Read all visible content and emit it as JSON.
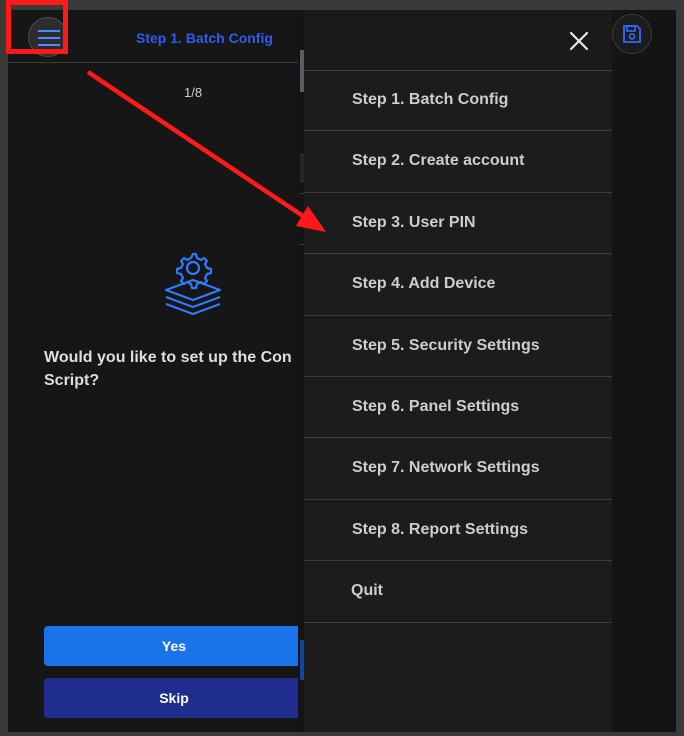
{
  "header": {
    "title": "Step 1. Batch Config",
    "menu_icon": "hamburger-menu-icon",
    "save_icon": "save-icon"
  },
  "pager": {
    "text": "1/8"
  },
  "question": {
    "line1": "Would you like to set up the Con",
    "line2": "Script?"
  },
  "buttons": {
    "yes": "Yes",
    "skip": "Skip"
  },
  "drawer": {
    "close_icon": "close-icon",
    "items": [
      {
        "label": "Step 1. Batch Config"
      },
      {
        "label": "Step 2. Create account"
      },
      {
        "label": "Step 3. User PIN"
      },
      {
        "label": "Step 4. Add Device"
      },
      {
        "label": "Step 5. Security Settings"
      },
      {
        "label": "Step 6. Panel Settings"
      },
      {
        "label": "Step 7. Network Settings"
      },
      {
        "label": "Step 8. Report Settings"
      },
      {
        "label": "Quit"
      }
    ]
  },
  "colors": {
    "accent_blue": "#1a73e8",
    "skip_blue": "#1f2d8f",
    "title_blue": "#2f5cf0",
    "highlight_red": "#ff1a1a"
  }
}
